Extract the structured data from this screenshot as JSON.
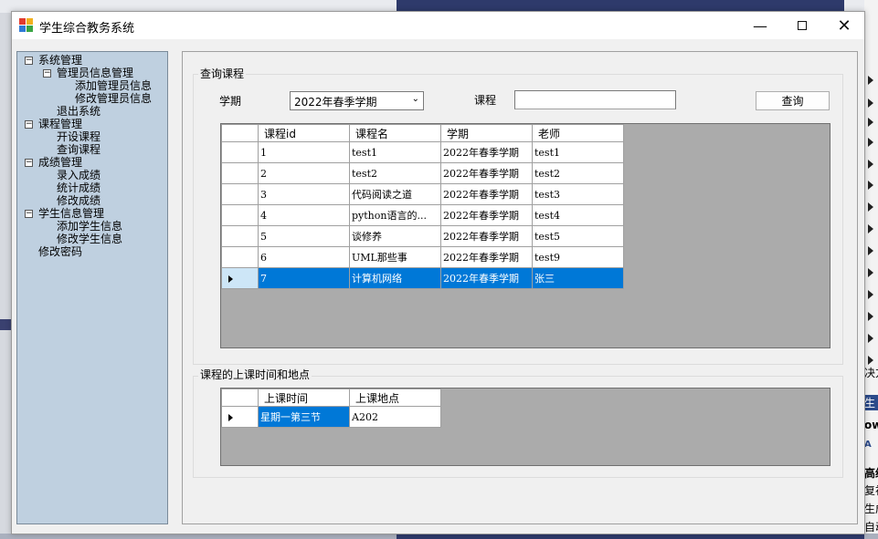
{
  "window": {
    "title": "学生综合教务系统"
  },
  "tree": [
    {
      "label": "系统管理",
      "level": 0,
      "expander": "−"
    },
    {
      "label": "管理员信息管理",
      "level": 1,
      "expander": "−"
    },
    {
      "label": "添加管理员信息",
      "level": 2,
      "expander": ""
    },
    {
      "label": "修改管理员信息",
      "level": 2,
      "expander": ""
    },
    {
      "label": "退出系统",
      "level": 1,
      "expander": ""
    },
    {
      "label": "课程管理",
      "level": 0,
      "expander": "−"
    },
    {
      "label": "开设课程",
      "level": 1,
      "expander": ""
    },
    {
      "label": "查询课程",
      "level": 1,
      "expander": ""
    },
    {
      "label": "成绩管理",
      "level": 0,
      "expander": "−"
    },
    {
      "label": "录入成绩",
      "level": 1,
      "expander": ""
    },
    {
      "label": "统计成绩",
      "level": 1,
      "expander": ""
    },
    {
      "label": "修改成绩",
      "level": 1,
      "expander": ""
    },
    {
      "label": "学生信息管理",
      "level": 0,
      "expander": "−"
    },
    {
      "label": "添加学生信息",
      "level": 1,
      "expander": ""
    },
    {
      "label": "修改学生信息",
      "level": 1,
      "expander": ""
    },
    {
      "label": "修改密码",
      "level": 0,
      "expander": ""
    }
  ],
  "query": {
    "group_title": "查询课程",
    "term_label": "学期",
    "term_value": "2022年春季学期",
    "course_label": "课程",
    "course_value": "",
    "search_button": "查询"
  },
  "courses": {
    "headers": [
      "课程id",
      "课程名",
      "学期",
      "老师"
    ],
    "rows": [
      [
        "1",
        "test1",
        "2022年春季学期",
        "test1"
      ],
      [
        "2",
        "test2",
        "2022年春季学期",
        "test2"
      ],
      [
        "3",
        "代码阅读之道",
        "2022年春季学期",
        "test3"
      ],
      [
        "4",
        "python语言的...",
        "2022年春季学期",
        "test4"
      ],
      [
        "5",
        "谈修养",
        "2022年春季学期",
        "test5"
      ],
      [
        "6",
        "UML那些事",
        "2022年春季学期",
        "test9"
      ],
      [
        "7",
        "计算机网络",
        "2022年春季学期",
        "张三"
      ]
    ],
    "selected_row": 6
  },
  "schedule": {
    "group_title": "课程的上课时间和地点",
    "headers": [
      "上课时间",
      "上课地点"
    ],
    "rows": [
      [
        "星期一第三节",
        "A202"
      ]
    ]
  },
  "background_text": [
    "决方",
    "生",
    "ow",
    "A",
    "高级",
    "复初",
    "生成",
    "自动"
  ]
}
